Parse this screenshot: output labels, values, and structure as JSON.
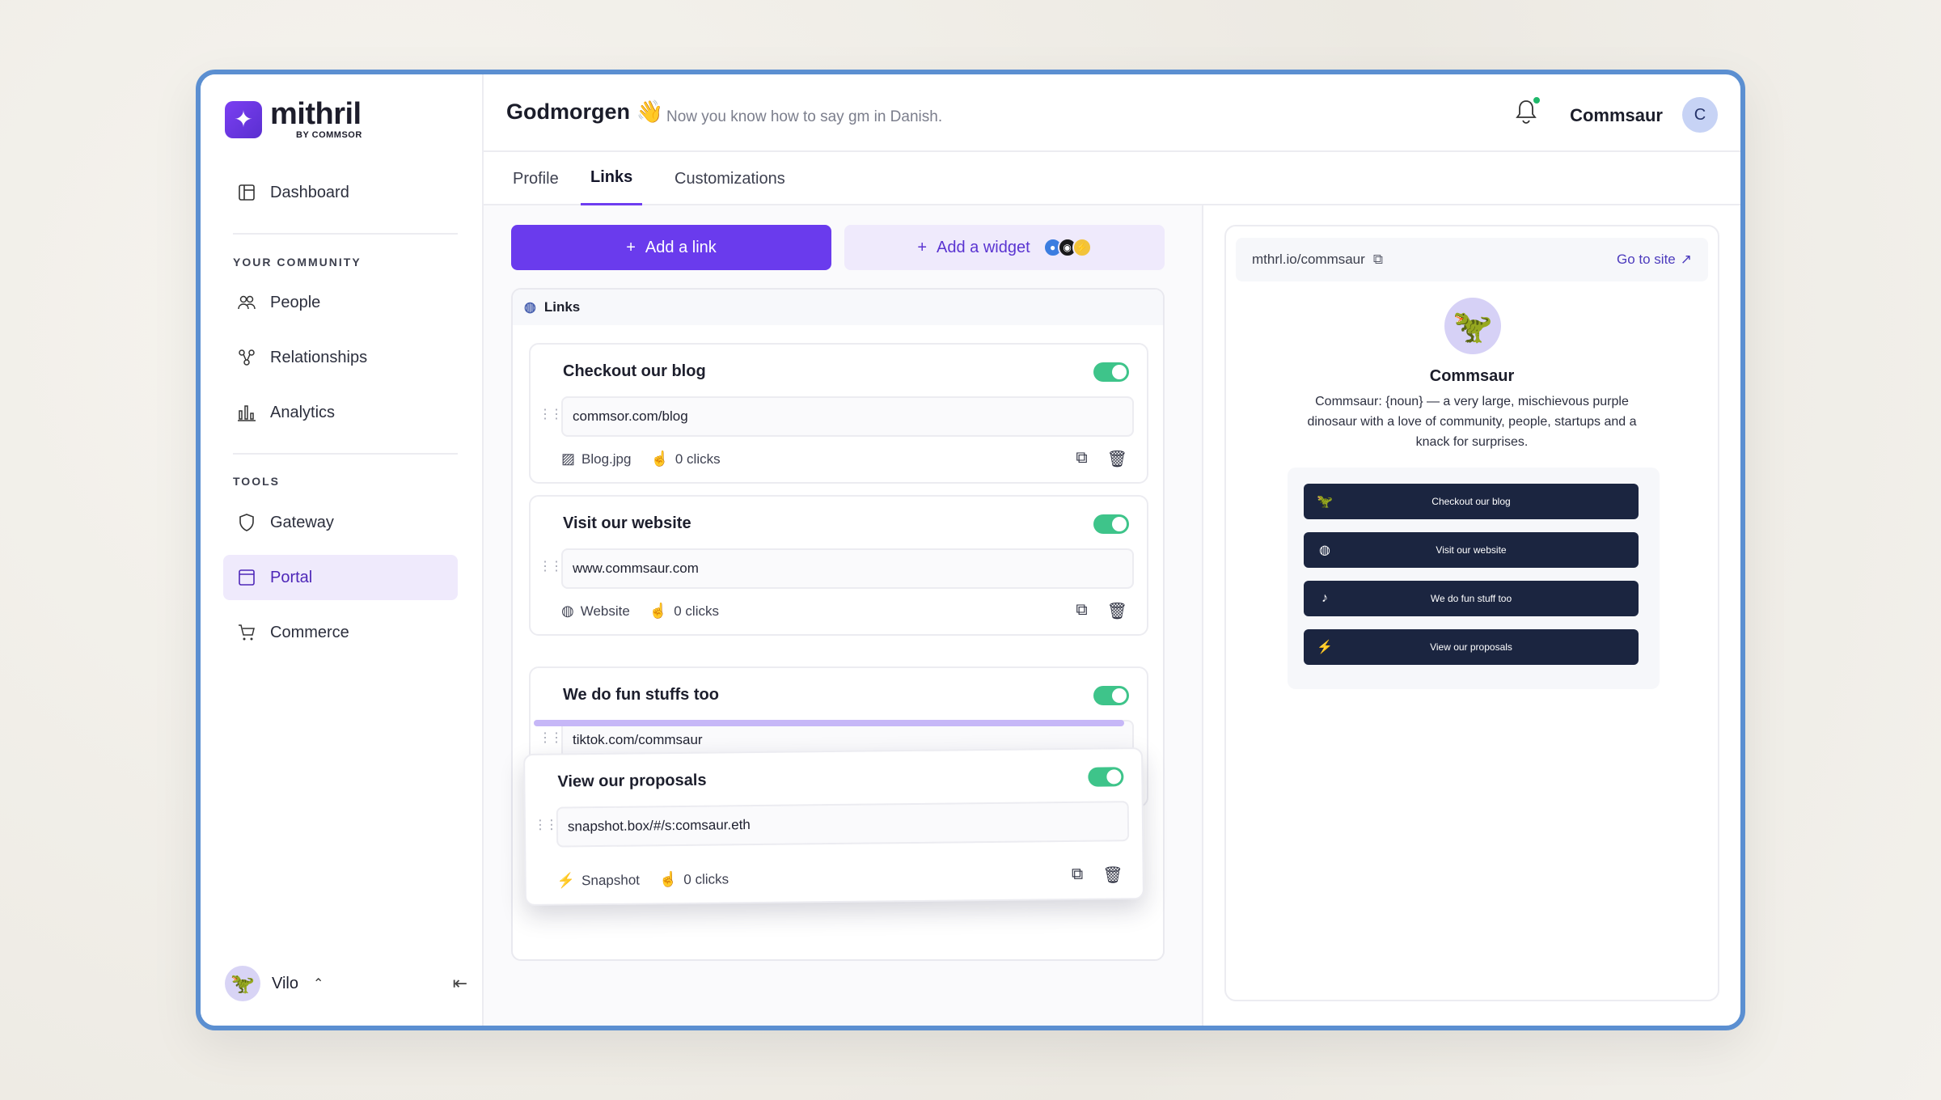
{
  "brand": {
    "name": "mithril",
    "sub": "BY COMMSOR"
  },
  "sidebar": {
    "dashboard": "Dashboard",
    "community_label": "YOUR COMMUNITY",
    "community_items": [
      "People",
      "Relationships",
      "Analytics"
    ],
    "tools_label": "TOOLS",
    "tools_items": [
      "Gateway",
      "Portal",
      "Commerce"
    ],
    "active_item": "Portal",
    "user_name": "Vilo"
  },
  "header": {
    "greeting": "Godmorgen",
    "greeting_sub": "Now you know how to say gm in Danish.",
    "account_name": "Commsaur",
    "account_initial": "C"
  },
  "tabs": [
    "Profile",
    "Links",
    "Customizations"
  ],
  "active_tab": "Links",
  "actions": {
    "add_link": "Add a link",
    "add_widget": "Add a widget"
  },
  "links_panel": {
    "title": "Links",
    "cards": [
      {
        "title": "Checkout our blog",
        "url": "commsor.com/blog",
        "type": "Blog.jpg",
        "clicks": "0 clicks",
        "enabled": true
      },
      {
        "title": "Visit our website",
        "url": "www.commsaur.com",
        "type": "Website",
        "clicks": "0 clicks",
        "enabled": true
      },
      {
        "title": "We do fun stuffs too",
        "url": "tiktok.com/commsaur",
        "enabled": true
      },
      {
        "title": "View our proposals",
        "url": "snapshot.box/#/s:comsaur.eth",
        "type": "Snapshot",
        "clicks": "0 clicks",
        "enabled": true
      }
    ]
  },
  "preview": {
    "url": "mthrl.io/commsaur",
    "go_to_site": "Go to site",
    "name": "Commsaur",
    "bio": "Commsaur: {noun} — a very large, mischievous purple dinosaur with a love of community, people, startups and a knack for surprises.",
    "buttons": [
      "Checkout our blog",
      "Visit our website",
      "We do fun stuff too",
      "View our proposals"
    ]
  },
  "colors": {
    "accent": "#6a3bed",
    "toggle_on": "#3ec48a",
    "frame": "#5b8fd1",
    "preview_button": "#1b2540"
  }
}
